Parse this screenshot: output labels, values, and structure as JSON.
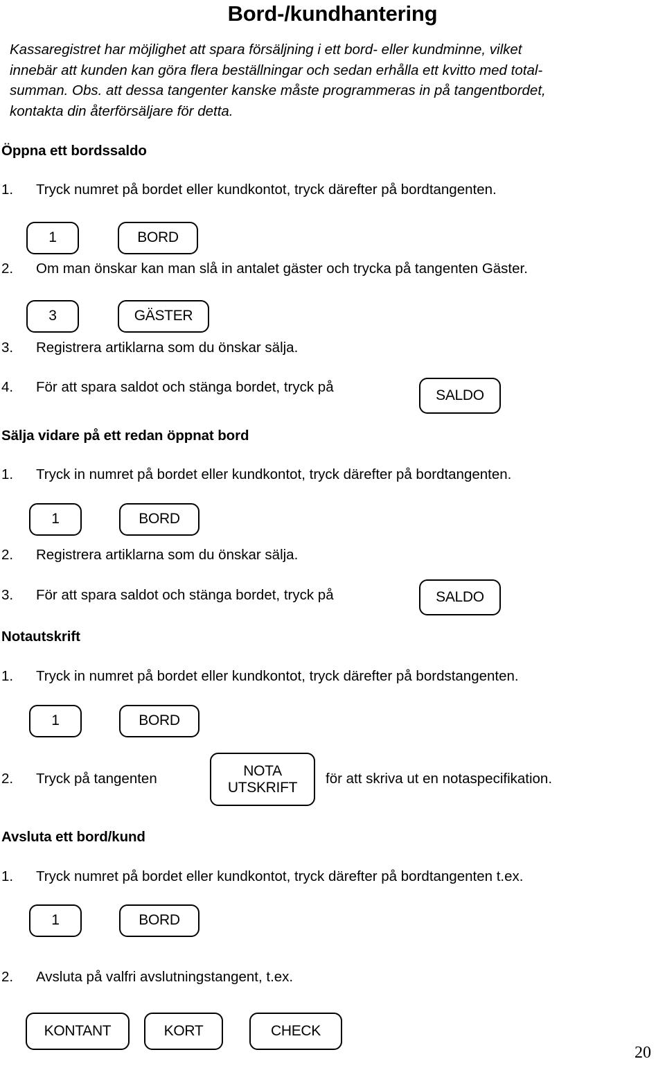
{
  "document": {
    "title": "Bord-/kundhantering",
    "page_number": "20"
  },
  "intro": {
    "line1": "Kassaregistret har möjlighet att spara försäljning i ett bord- eller kundminne, vilket",
    "line2": "innebär att kunden kan göra flera beställningar och sedan erhålla ett kvitto med total-",
    "line3": "summan. Obs. att dessa tangenter kanske måste programmeras in på tangentbordet,",
    "line4": "kontakta din återförsäljare för detta."
  },
  "sections": {
    "open_balance": {
      "heading": "Öppna ett bordssaldo",
      "step1_num": "1.",
      "step1_text": "Tryck numret på bordet eller kundkontot, tryck därefter på bordtangenten.",
      "step1_key_number": "1",
      "step1_key_bord": "BORD",
      "step2_num": "2.",
      "step2_text": "Om man önskar kan man slå in antalet gäster och trycka på tangenten Gäster.",
      "step2_key_number": "3",
      "step2_key_gaster": "GÄSTER",
      "step3_num": "3.",
      "step3_text": "Registrera artiklarna som du önskar sälja.",
      "step4_num": "4.",
      "step4_text": "För att spara saldot och stänga bordet, tryck på",
      "step4_key_saldo": "SALDO"
    },
    "sell_more": {
      "heading": "Sälja vidare på ett redan öppnat bord",
      "step1_num": "1.",
      "step1_text": "Tryck in numret på bordet eller kundkontot, tryck därefter på bordtangenten.",
      "step1_key_number": "1",
      "step1_key_bord": "BORD",
      "step2_num": "2.",
      "step2_text": "Registrera artiklarna som du önskar sälja.",
      "step3_num": "3.",
      "step3_text": "För att spara saldot och stänga bordet, tryck på",
      "step3_key_saldo": "SALDO"
    },
    "receipt_print": {
      "heading": "Notautskrift",
      "step1_num": "1.",
      "step1_text": "Tryck in numret på bordet eller kundkontot, tryck därefter på bordstangenten.",
      "step1_key_number": "1",
      "step1_key_bord": "BORD",
      "step2_num": "2.",
      "step2_text": "Tryck på tangenten",
      "step2_key_nota": "NOTA\nUTSKRIFT",
      "step2_text_after": "för att skriva ut en notaspecifikation."
    },
    "close_table": {
      "heading": "Avsluta ett bord/kund",
      "step1_num": "1.",
      "step1_text": "Tryck numret på bordet eller kundkontot, tryck därefter på bordtangenten t.ex.",
      "step1_key_number": "1",
      "step1_key_bord": "BORD",
      "step2_num": "2.",
      "step2_text": "Avsluta på valfri avslutningstangent, t.ex.",
      "step2_key_kontant": "KONTANT",
      "step2_key_kort": "KORT",
      "step2_key_check": "CHECK"
    }
  }
}
